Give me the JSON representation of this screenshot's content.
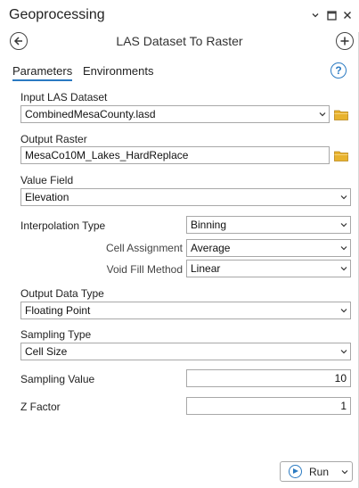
{
  "window": {
    "title": "Geoprocessing"
  },
  "tool": {
    "title": "LAS Dataset To Raster"
  },
  "tabs": [
    {
      "label": "Parameters",
      "active": true
    },
    {
      "label": "Environments",
      "active": false
    }
  ],
  "params": {
    "input_las": {
      "label": "Input LAS Dataset",
      "value": "CombinedMesaCounty.lasd"
    },
    "output_raster": {
      "label": "Output Raster",
      "value": "MesaCo10M_Lakes_HardReplace"
    },
    "value_field": {
      "label": "Value Field",
      "value": "Elevation"
    },
    "interpolation_type": {
      "label": "Interpolation Type",
      "value": "Binning"
    },
    "cell_assignment": {
      "label": "Cell Assignment",
      "value": "Average"
    },
    "void_fill_method": {
      "label": "Void Fill Method",
      "value": "Linear"
    },
    "output_data_type": {
      "label": "Output Data Type",
      "value": "Floating Point"
    },
    "sampling_type": {
      "label": "Sampling Type",
      "value": "Cell Size"
    },
    "sampling_value": {
      "label": "Sampling Value",
      "value": "10"
    },
    "z_factor": {
      "label": "Z Factor",
      "value": "1"
    }
  },
  "run": {
    "label": "Run"
  },
  "colors": {
    "accent": "#2a7ac2",
    "folder": "#e8b32e"
  }
}
